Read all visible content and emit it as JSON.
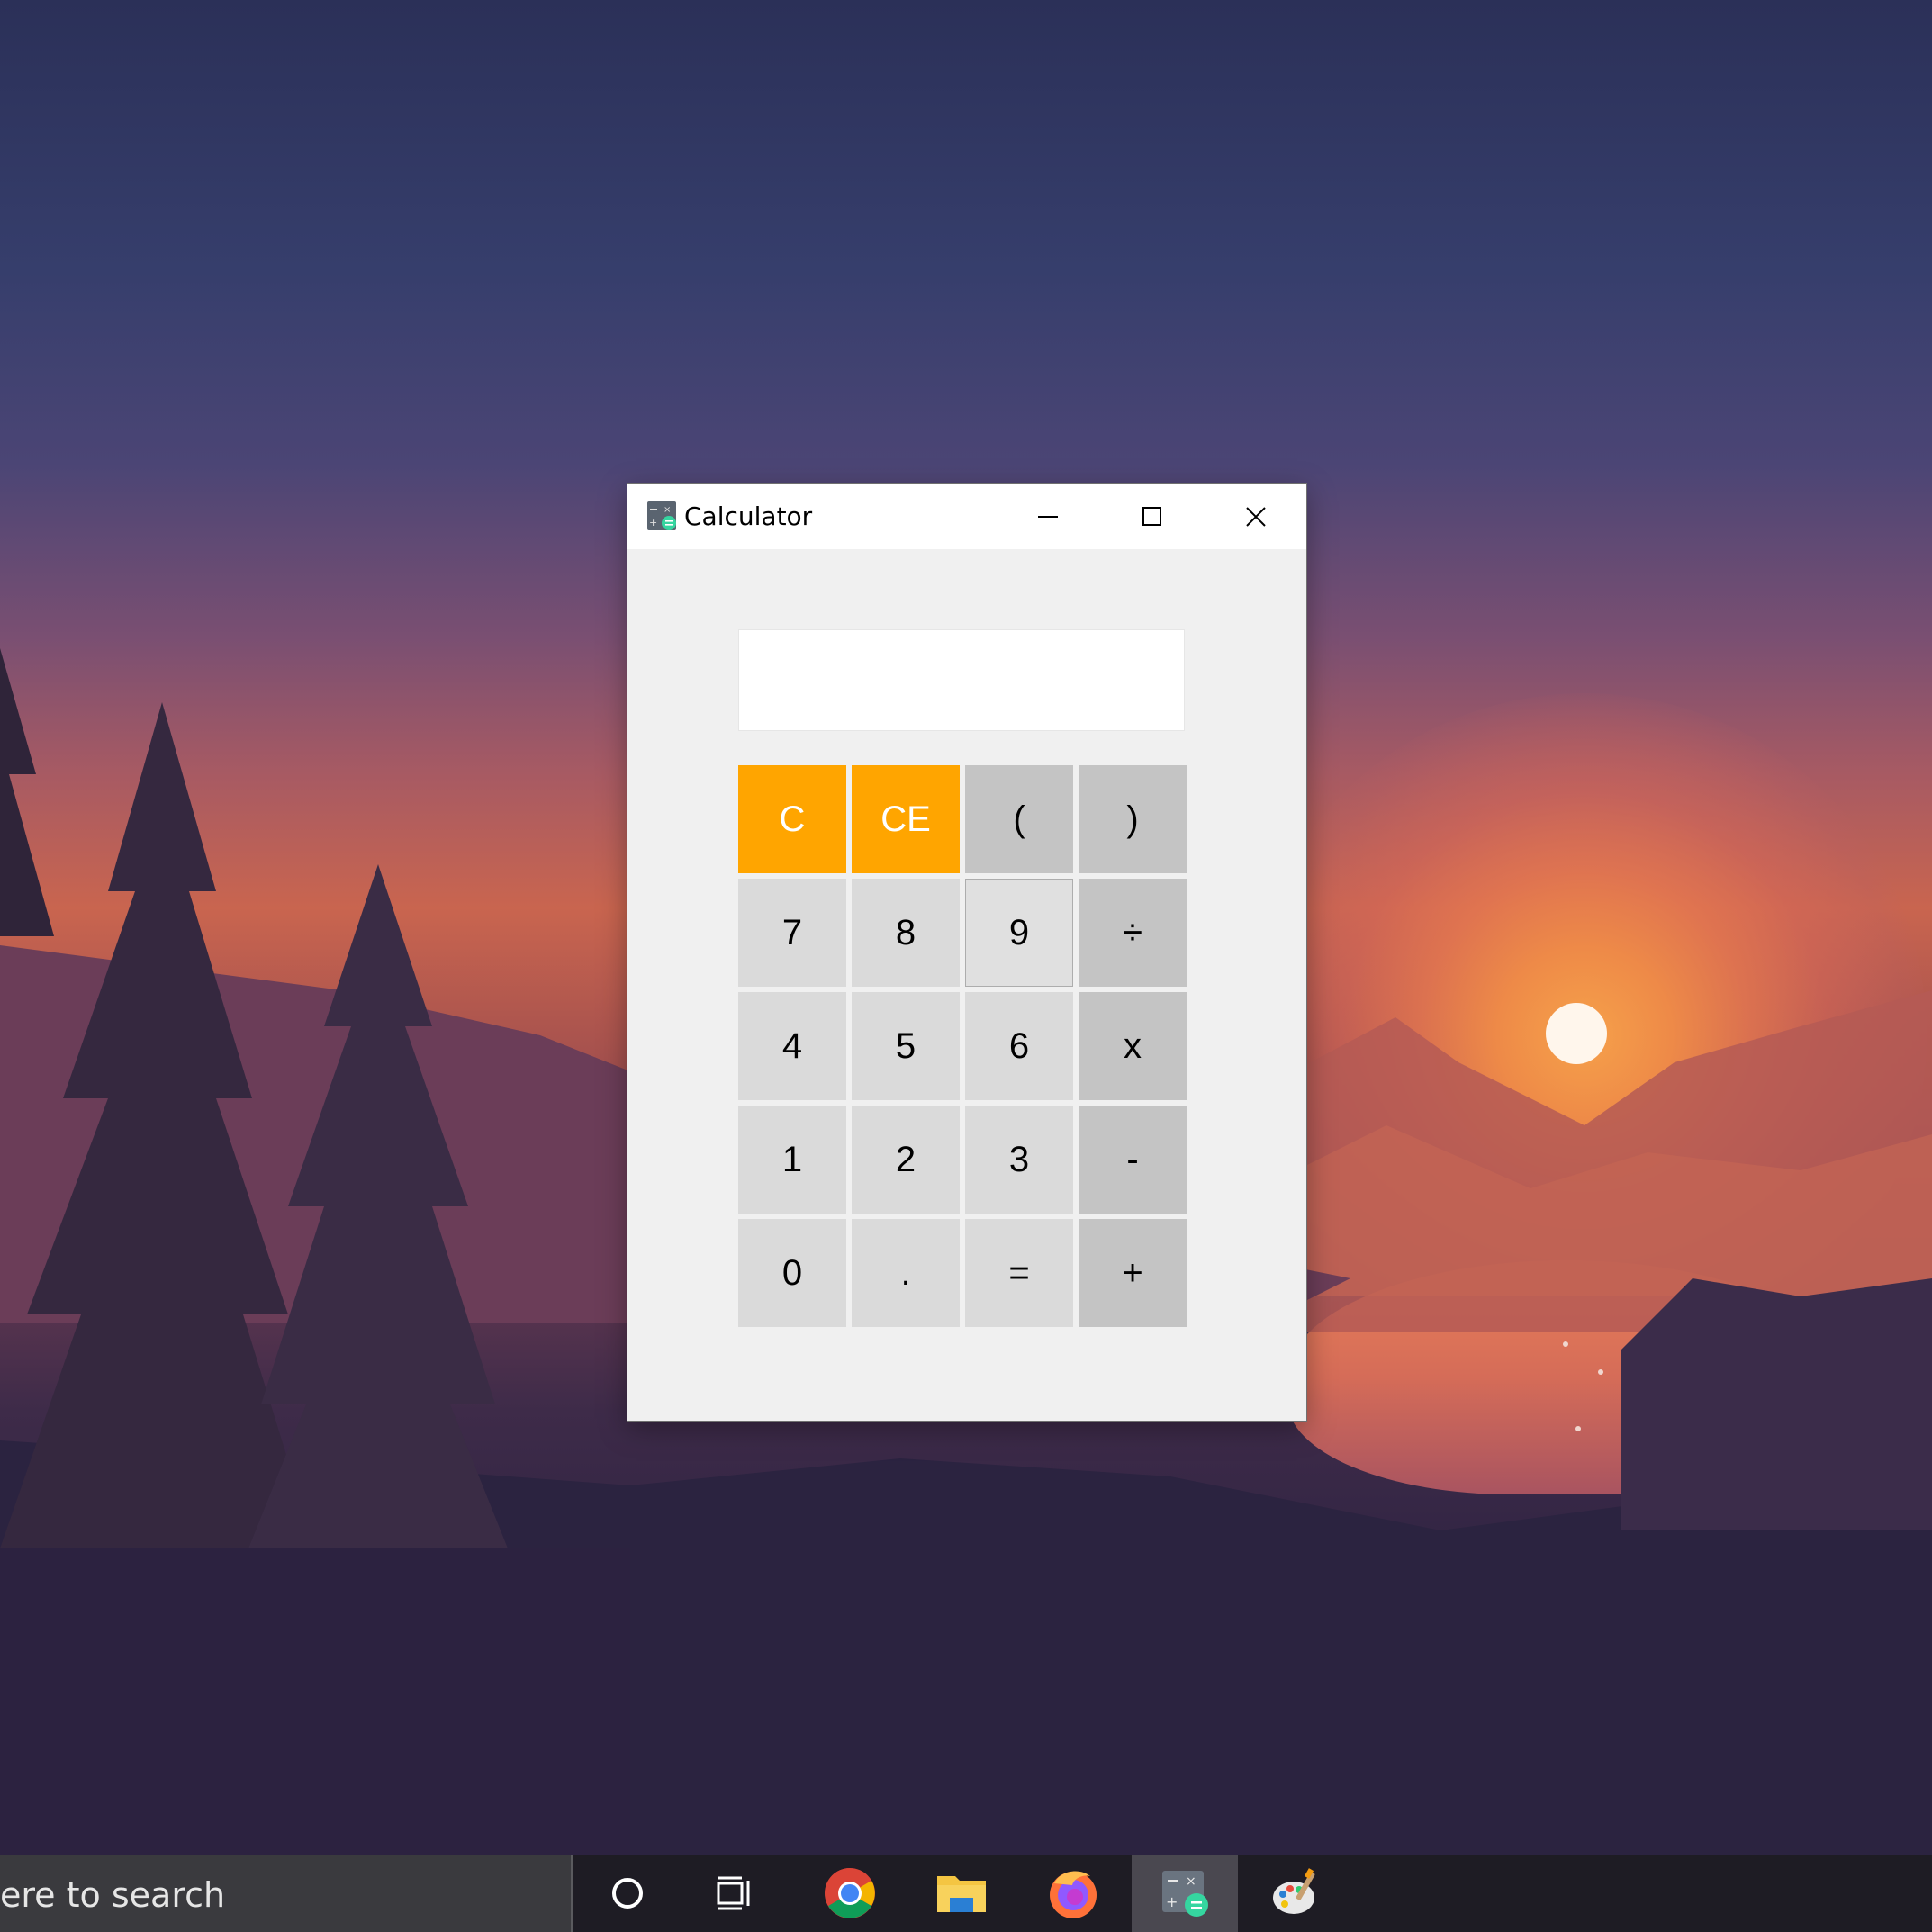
{
  "window": {
    "title": "Calculator",
    "app_icon": "calculator-app-icon",
    "controls": [
      "minimize-icon",
      "maximize-icon",
      "close-icon"
    ]
  },
  "display": {
    "value": ""
  },
  "keypad": {
    "rows": [
      [
        "C",
        "CE",
        "(",
        ")"
      ],
      [
        "7",
        "8",
        "9",
        "÷"
      ],
      [
        "4",
        "5",
        "6",
        "x"
      ],
      [
        "1",
        "2",
        "3",
        "-"
      ],
      [
        "0",
        ".",
        "=",
        "+"
      ]
    ]
  },
  "colors": {
    "clear_keys": "#ffa500",
    "digit_keys": "#dadada",
    "operator_keys": "#c4c4c4",
    "window_bg": "#f0f0f0"
  },
  "taskbar": {
    "search_text": "ere to search",
    "icons": [
      "cortana-icon",
      "task-view-icon",
      "chrome-icon",
      "file-explorer-icon",
      "firefox-icon",
      "calculator-icon",
      "paint-icon"
    ],
    "active": "calculator-icon"
  }
}
